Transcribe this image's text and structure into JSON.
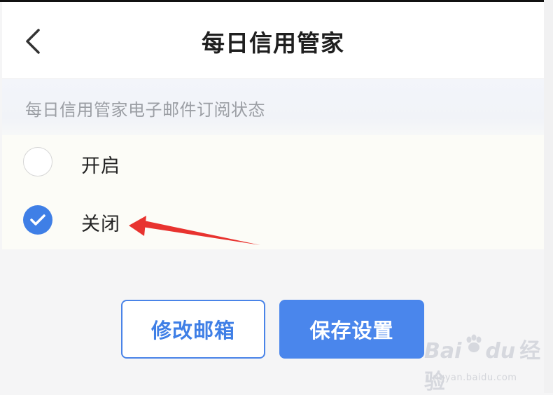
{
  "header": {
    "title": "每日信用管家",
    "back_icon": "chevron-left-icon"
  },
  "subscription": {
    "section_label": "每日信用管家电子邮件订阅状态",
    "options": [
      {
        "label": "开启",
        "selected": false
      },
      {
        "label": "关闭",
        "selected": true
      }
    ]
  },
  "actions": {
    "edit_email_label": "修改邮箱",
    "save_settings_label": "保存设置"
  },
  "watermark": {
    "brand_left": "Bai",
    "brand_right": "du",
    "brand_cn": "经验",
    "url": "jingyan.baidu.com"
  },
  "colors": {
    "accent": "#3f7fe6",
    "annotation": "#e8332f"
  }
}
